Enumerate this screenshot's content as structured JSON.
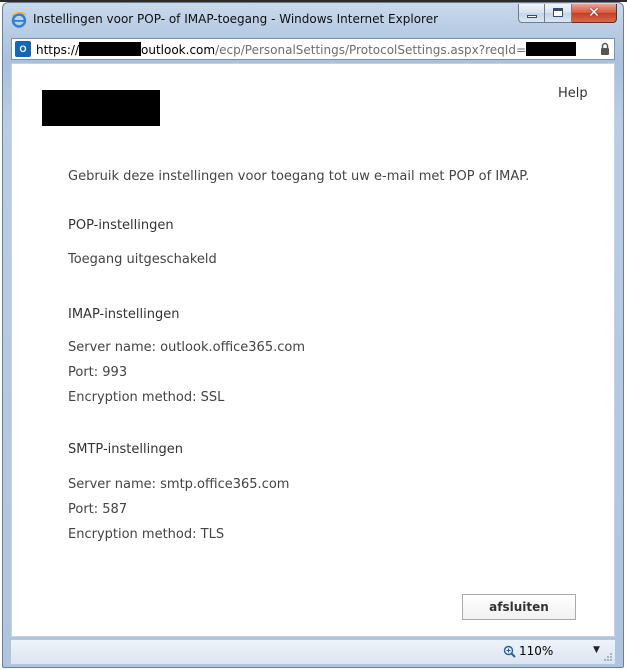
{
  "window": {
    "title": "Instellingen voor POP- of IMAP-toegang - Windows Internet Explorer",
    "buttons": {
      "minimize_icon": "minimize-icon",
      "maximize_icon": "maximize-icon",
      "close_icon": "close-icon"
    }
  },
  "address": {
    "scheme": "https://",
    "host": "outlook.com",
    "path": "/ecp/PersonalSettings/ProtocolSettings.aspx?reqId="
  },
  "header": {
    "help_label": "Help"
  },
  "intro": "Gebruik deze instellingen voor toegang tot uw e-mail met POP of IMAP.",
  "pop": {
    "heading": "POP-instellingen",
    "status": "Toegang uitgeschakeld"
  },
  "imap": {
    "heading": "IMAP-instellingen",
    "server": "Server name: outlook.office365.com",
    "port": "Port: 993",
    "encryption": "Encryption method: SSL"
  },
  "smtp": {
    "heading": "SMTP-instellingen",
    "server": "Server name: smtp.office365.com",
    "port": "Port: 587",
    "encryption": "Encryption method: TLS"
  },
  "footer": {
    "close_label": "afsluiten"
  },
  "status_bar": {
    "zoom": "110%"
  }
}
